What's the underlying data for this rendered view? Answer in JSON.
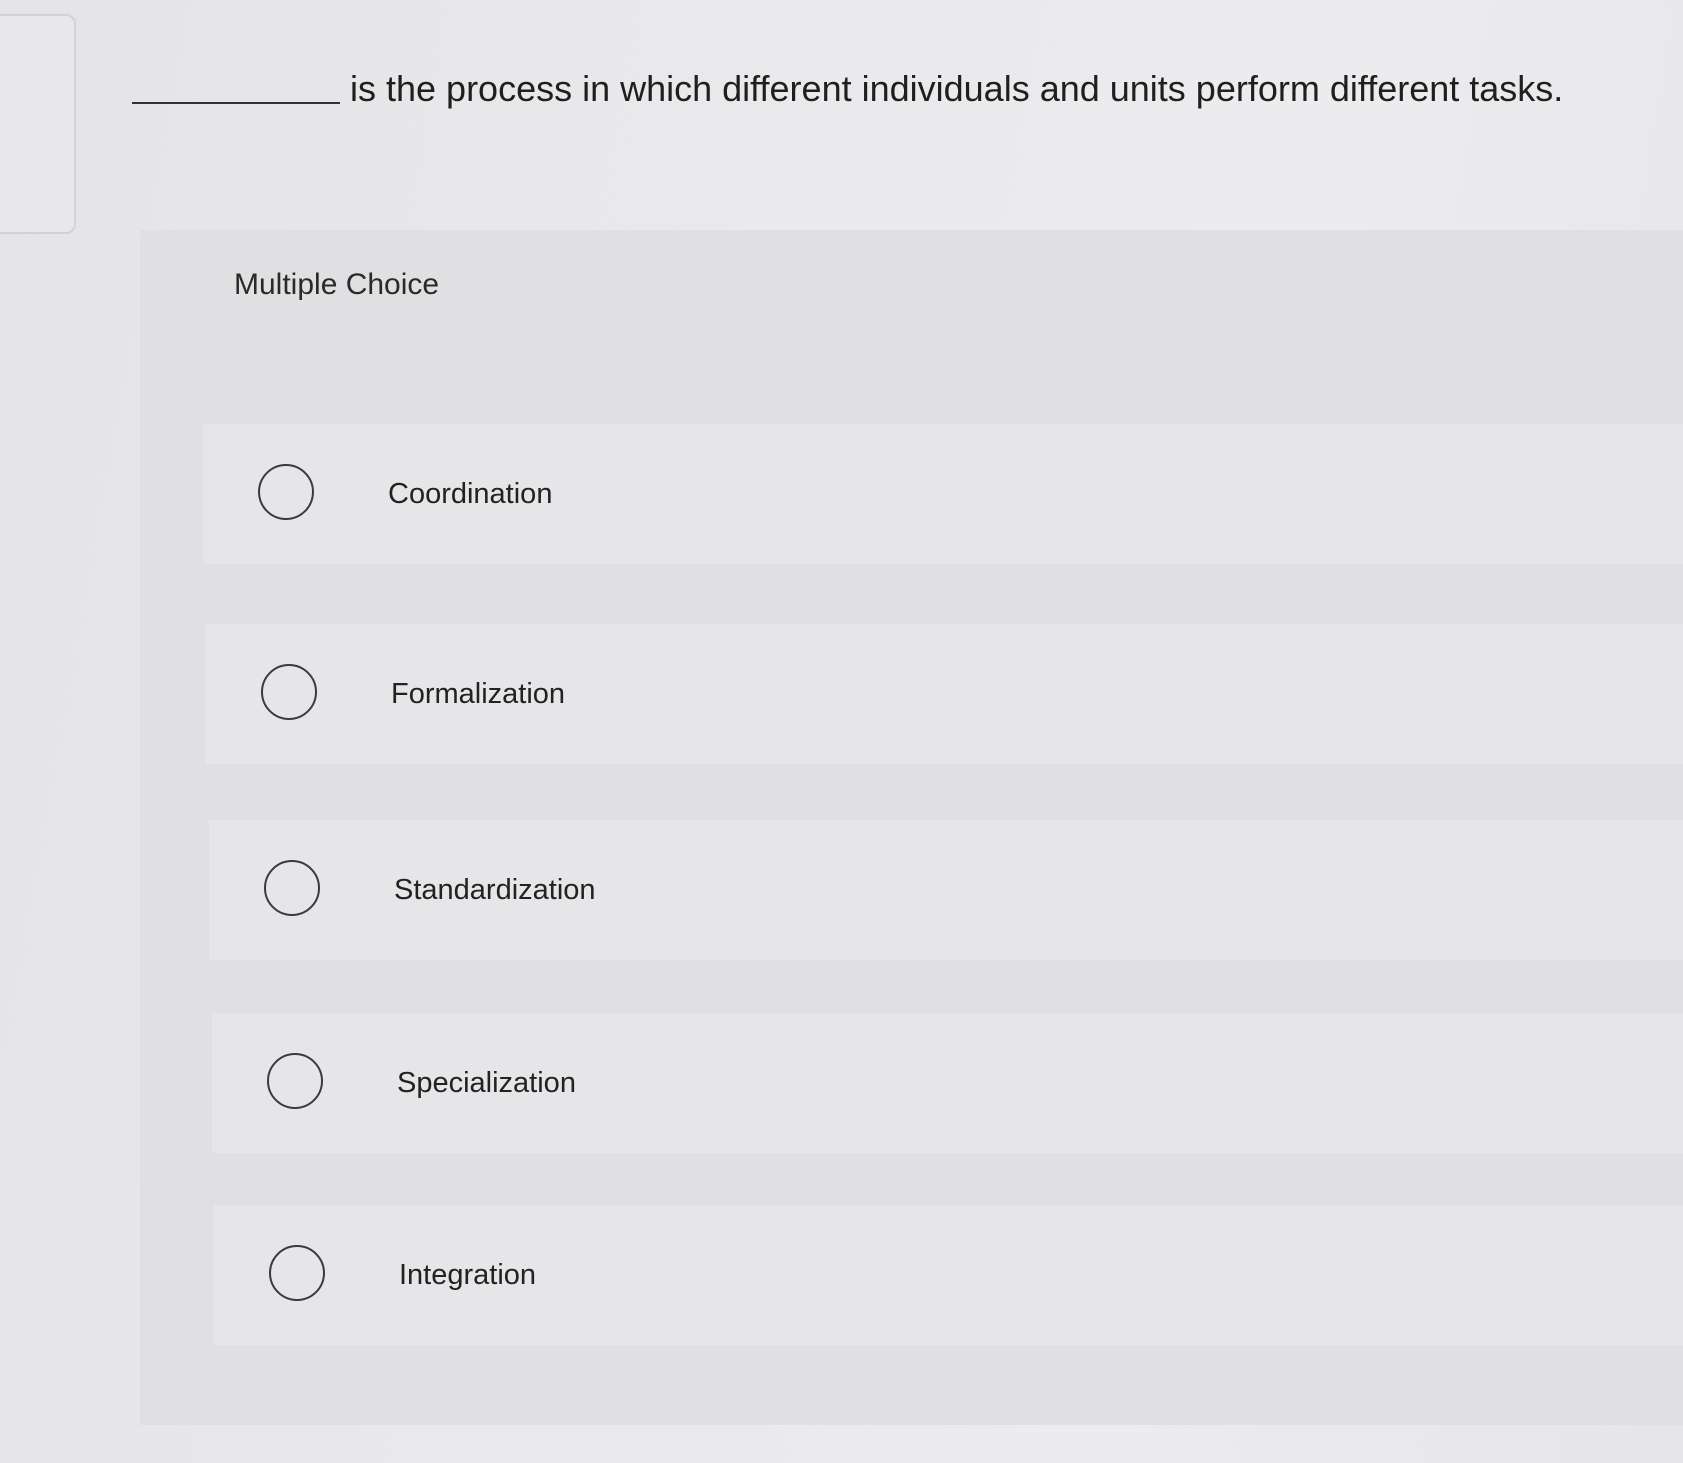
{
  "question": {
    "text": "is the process in which different individuals and units perform different tasks."
  },
  "section_label": "Multiple Choice",
  "options": [
    {
      "label": "Coordination"
    },
    {
      "label": "Formalization"
    },
    {
      "label": "Standardization"
    },
    {
      "label": "Specialization"
    },
    {
      "label": "Integration"
    }
  ]
}
